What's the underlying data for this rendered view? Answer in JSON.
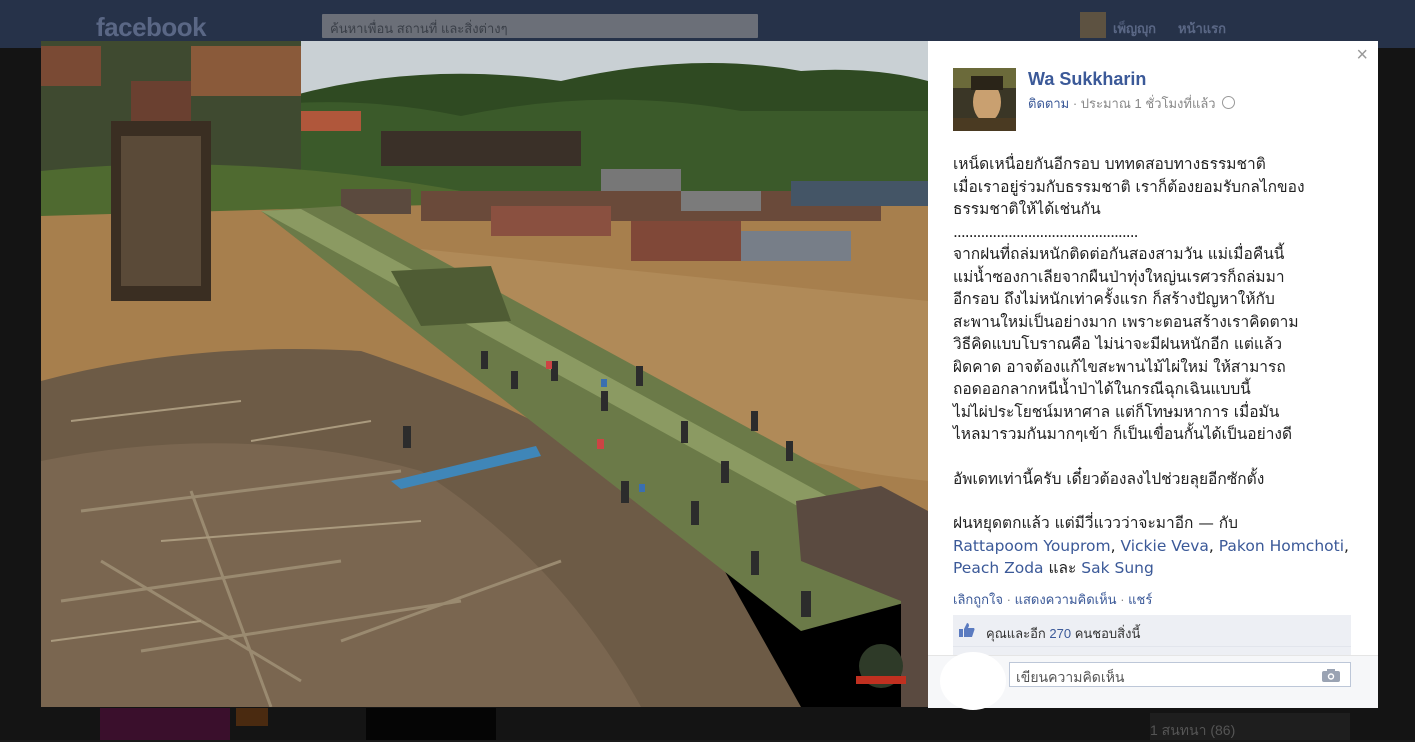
{
  "topbar": {
    "logo": "facebook",
    "search_placeholder": "ค้นหาเพื่อน สถานที่ และสิ่งต่างๆ",
    "nav": [
      "เพ็ญญุก",
      "หน้าแรก"
    ]
  },
  "background": {
    "chat_label": "1 สนทนา (86)"
  },
  "lightbox": {
    "close_glyph": "×",
    "author": {
      "name": "Wa Sukkharin",
      "follow": "ติดตาม",
      "separator": " · ",
      "time": "ประมาณ 1 ชั่วโมงที่แล้ว",
      "privacy_icon": "globe-icon"
    },
    "post": {
      "lines_block1": [
        "เหน็ดเหนื่อยกันอีกรอบ บททดสอบทางธรรมชาติ",
        "เมื่อเราอยู่ร่วมกับธรรมชาติ เราก็ต้องยอมรับกลไกของ",
        "ธรรมชาติให้ได้เช่นกัน",
        "...............................................",
        "จากฝนที่ถล่มหนักติดต่อกันสองสามวัน แม่เมื่อคืนนี้",
        "แม่น้ำซองกาเลียจากผืนป่าทุ่งใหญ่นเรศวรก็ถล่มมา",
        "อีกรอบ ถึงไม่หนักเท่าครั้งแรก ก็สร้างปัญหาให้กับ",
        "สะพานใหม่เป็นอย่างมาก เพราะตอนสร้างเราคิดตาม",
        "วิธีคิดแบบโบราณคือ ไม่น่าจะมีฝนหนักอีก แต่แล้ว",
        "ผิดคาด อาจต้องแก้ไขสะพานไม้ไผ่ใหม่ ให้สามารถ",
        "ถอดออกลากหนีน้ำป่าได้ในกรณีฉุกเฉินแบบนี้",
        "ไม่ไผ่ประโยชน์มหาศาล แต่ก็โทษมหาการ เมื่อมัน",
        "ไหลมารวมกันมากๆเข้า ก็เป็นเขื่อนกั้นได้เป็นอย่างดี"
      ],
      "update_line": "อัพเดทเท่านี้ครับ เดี๋ยวต้องลงไปช่วยลุยอีกซักตั้ง",
      "closing_line": "ฝนหยุดตกแล้ว แต่มีวี่แววว่าจะมาอีก — กับ",
      "tagged": [
        "Rattapoom Youprom",
        "Vickie Veva",
        "Pakon Homchoti",
        "Peach Zoda",
        "Sak Sung"
      ],
      "tag_and": "และ"
    },
    "actions": {
      "unlike": "เลิกถูกใจ",
      "comment": "แสดงความคิดเห็น",
      "share": "แชร์",
      "dot": " · "
    },
    "likes": {
      "prefix": "คุณและอีก",
      "count": "270",
      "suffix": "คนชอบสิ่งนี้"
    },
    "comment_placeholder": "เขียนความคิดเห็น",
    "photo_watermark": "logo"
  },
  "colors": {
    "link": "#3b5998",
    "topbar": "#263249",
    "water": "#a77f4d"
  }
}
